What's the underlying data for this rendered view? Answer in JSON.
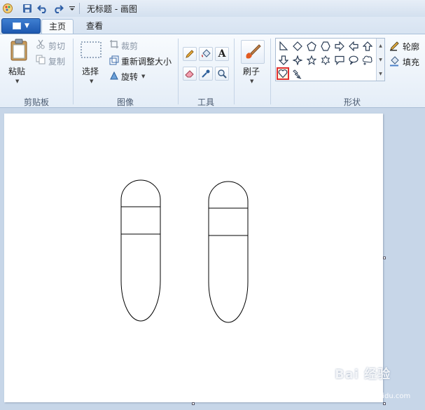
{
  "window": {
    "title": "无标题 - 画图"
  },
  "tabs": [
    {
      "label": "主页",
      "active": true
    },
    {
      "label": "查看",
      "active": false
    }
  ],
  "clipboard": {
    "paste_label": "粘贴",
    "cut_label": "剪切",
    "copy_label": "复制",
    "group_label": "剪贴板"
  },
  "image": {
    "select_label": "选择",
    "crop_label": "裁剪",
    "resize_label": "重新调整大小",
    "rotate_label": "旋转",
    "group_label": "图像"
  },
  "tools": {
    "group_label": "工具",
    "text_tool_glyph": "A"
  },
  "brushes": {
    "label": "刷子"
  },
  "shapes": {
    "group_label": "形状",
    "outline_label": "轮廓",
    "fill_label": "填充",
    "selected": "heart",
    "items_row1": [
      "right-triangle",
      "diamond",
      "pentagon",
      "hexagon",
      "arrow-right",
      "arrow-left",
      "arrow-up"
    ],
    "items_row2": [
      "arrow-down",
      "star-4",
      "star-5",
      "star-6",
      "callout-rect",
      "callout-oval",
      "callout-cloud"
    ],
    "items_row3": [
      "heart",
      "lightning"
    ]
  },
  "colors": {
    "ribbon_blue": "#1d58b0",
    "selection_red": "#e03030",
    "canvas_bg": "#ffffff",
    "workspace_bg": "#c7d6e8"
  },
  "watermark": {
    "text": "Bai 经验",
    "sub": "jingyan.baidu.com"
  }
}
